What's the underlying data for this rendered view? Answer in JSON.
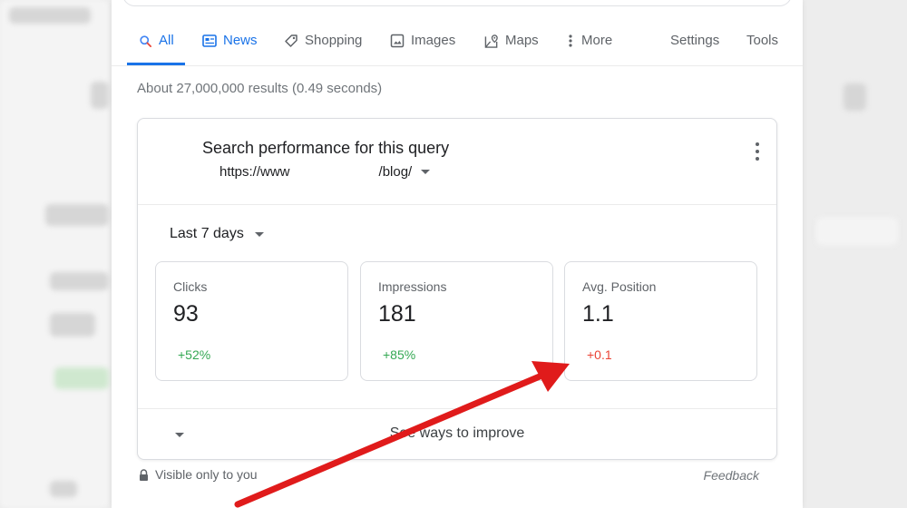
{
  "tabs": [
    {
      "label": "All",
      "icon": "search-icon",
      "active": true
    },
    {
      "label": "News",
      "icon": "news-icon"
    },
    {
      "label": "Shopping",
      "icon": "tag-icon"
    },
    {
      "label": "Images",
      "icon": "image-icon"
    },
    {
      "label": "Maps",
      "icon": "map-icon"
    },
    {
      "label": "More",
      "icon": "more-vertical-icon"
    },
    {
      "label": "Settings"
    },
    {
      "label": "Tools"
    }
  ],
  "result_stats": "About 27,000,000 results (0.49 seconds)",
  "card": {
    "title": "Search performance for this query",
    "url_start": "https://www",
    "url_end": "/blog/",
    "range": "Last 7 days",
    "metrics": [
      {
        "label": "Clicks",
        "value": "93",
        "delta": "+52%",
        "trend": "up"
      },
      {
        "label": "Impressions",
        "value": "181",
        "delta": "+85%",
        "trend": "up"
      },
      {
        "label": "Avg. Position",
        "value": "1.1",
        "delta": "+0.1",
        "trend": "down"
      }
    ],
    "improve": "See ways to improve"
  },
  "footer": {
    "visibility": "Visible only to you",
    "feedback": "Feedback"
  },
  "colors": {
    "accent": "#1a73e8",
    "positive": "#34a853",
    "negative": "#ea4335",
    "annotation_arrow": "#e01b1b"
  }
}
